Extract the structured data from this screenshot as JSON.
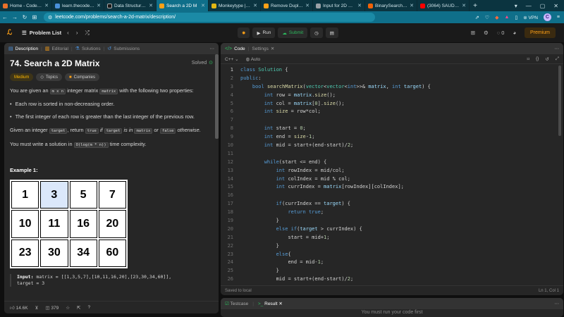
{
  "browser": {
    "tabs": [
      {
        "label": "Home - CodeHelp",
        "color": "#e8712a",
        "active": false
      },
      {
        "label": "learn.thecodehelp.i",
        "color": "#4a90d9",
        "active": false
      },
      {
        "label": "Data Structures & A",
        "color": "#1a1a1a",
        "active": false
      },
      {
        "label": "Search a 2D M",
        "color": "#ffa116",
        "active": true
      },
      {
        "label": "Monkeytype | A mi",
        "color": "#e2b714",
        "active": false
      },
      {
        "label": "Remove Duplicates",
        "color": "#ffa116",
        "active": false
      },
      {
        "label": "Input for 2D Vector",
        "color": "#9aa0a6",
        "active": false
      },
      {
        "label": "BinarySearch - Repl",
        "color": "#f26207",
        "active": false
      },
      {
        "label": "(3064) SAUDEBAZI",
        "color": "#ff0000",
        "active": false
      }
    ],
    "url": "leetcode.com/problems/search-a-2d-matrix/description/",
    "vpn_label": "VPN",
    "window_controls": [
      "—",
      "▢",
      "✕"
    ]
  },
  "lc_header": {
    "problem_list_label": "Problem List",
    "run_label": "Run",
    "submit_label": "Submit",
    "streak_count": "0",
    "premium_label": "Premium"
  },
  "left_panel": {
    "tabs": [
      {
        "label": "Description",
        "icon": "document-icon"
      },
      {
        "label": "Editorial",
        "icon": "book-icon"
      },
      {
        "label": "Solutions",
        "icon": "flask-icon"
      },
      {
        "label": "Submissions",
        "icon": "history-icon"
      }
    ],
    "title": "74. Search a 2D Matrix",
    "solved_label": "Solved",
    "pills": {
      "difficulty": "Medium",
      "topics": "Topics",
      "companies": "Companies"
    },
    "intro": {
      "p1": "You are given an ",
      "c1": "m x n",
      "p2": " integer matrix ",
      "c2": "matrix",
      "p3": " with the following two properties:"
    },
    "bullets": [
      "Each row is sorted in non-decreasing order.",
      "The first integer of each row is greater than the last integer of the previous row."
    ],
    "given": {
      "p1": "Given an integer ",
      "c1": "target",
      "p2": ", return ",
      "c2": "true",
      "p3": " if ",
      "c3": "target",
      "p4": " is in ",
      "c4": "matrix",
      "p5": " or ",
      "c5": "false",
      "p6": " otherwise."
    },
    "complexity": {
      "p1": "You must write a solution in ",
      "c1": "O(log(m * n))",
      "p2": " time complexity."
    },
    "example_title": "Example 1:",
    "matrix": [
      1,
      3,
      5,
      7,
      10,
      11,
      16,
      20,
      23,
      30,
      34,
      60
    ],
    "highlighted_value": 3,
    "example_input_label": "Input:",
    "example_input": " matrix = [[1,3,5,7],[10,11,16,20],[23,30,34,60]],",
    "example_target": "target = 3",
    "likes": "14.6K",
    "comments": "379"
  },
  "code_panel": {
    "tabs": [
      {
        "label": "Code"
      },
      {
        "label": "Settings"
      }
    ],
    "language": "C++",
    "autocomplete": "Auto",
    "lines": [
      "class Solution {",
      "public:",
      "    bool searchMatrix(vector<vector<int>>& matrix, int target) {",
      "        int row = matrix.size();",
      "        int col = matrix[0].size();",
      "        int size = row*col;",
      "",
      "        int start = 0;",
      "        int end = size-1;",
      "        int mid = start+(end-start)/2;",
      "",
      "        while(start <= end) {",
      "            int rowIndex = mid/col;",
      "            int colIndex = mid % col;",
      "            int currIndex = matrix[rowIndex][colIndex];",
      "",
      "            if(currIndex == target) {",
      "                return true;",
      "            }",
      "            else if(target > currIndex) {",
      "                start = mid+1;",
      "            }",
      "            else{",
      "                end = mid-1;",
      "            }",
      "            mid = start+(end-start)/2;"
    ],
    "saved_label": "Saved to local",
    "cursor_pos": "Ln 1, Col 1"
  },
  "bottom_panel": {
    "tabs": [
      {
        "label": "Testcase"
      },
      {
        "label": "Result"
      }
    ],
    "message": "You must run your code first"
  }
}
